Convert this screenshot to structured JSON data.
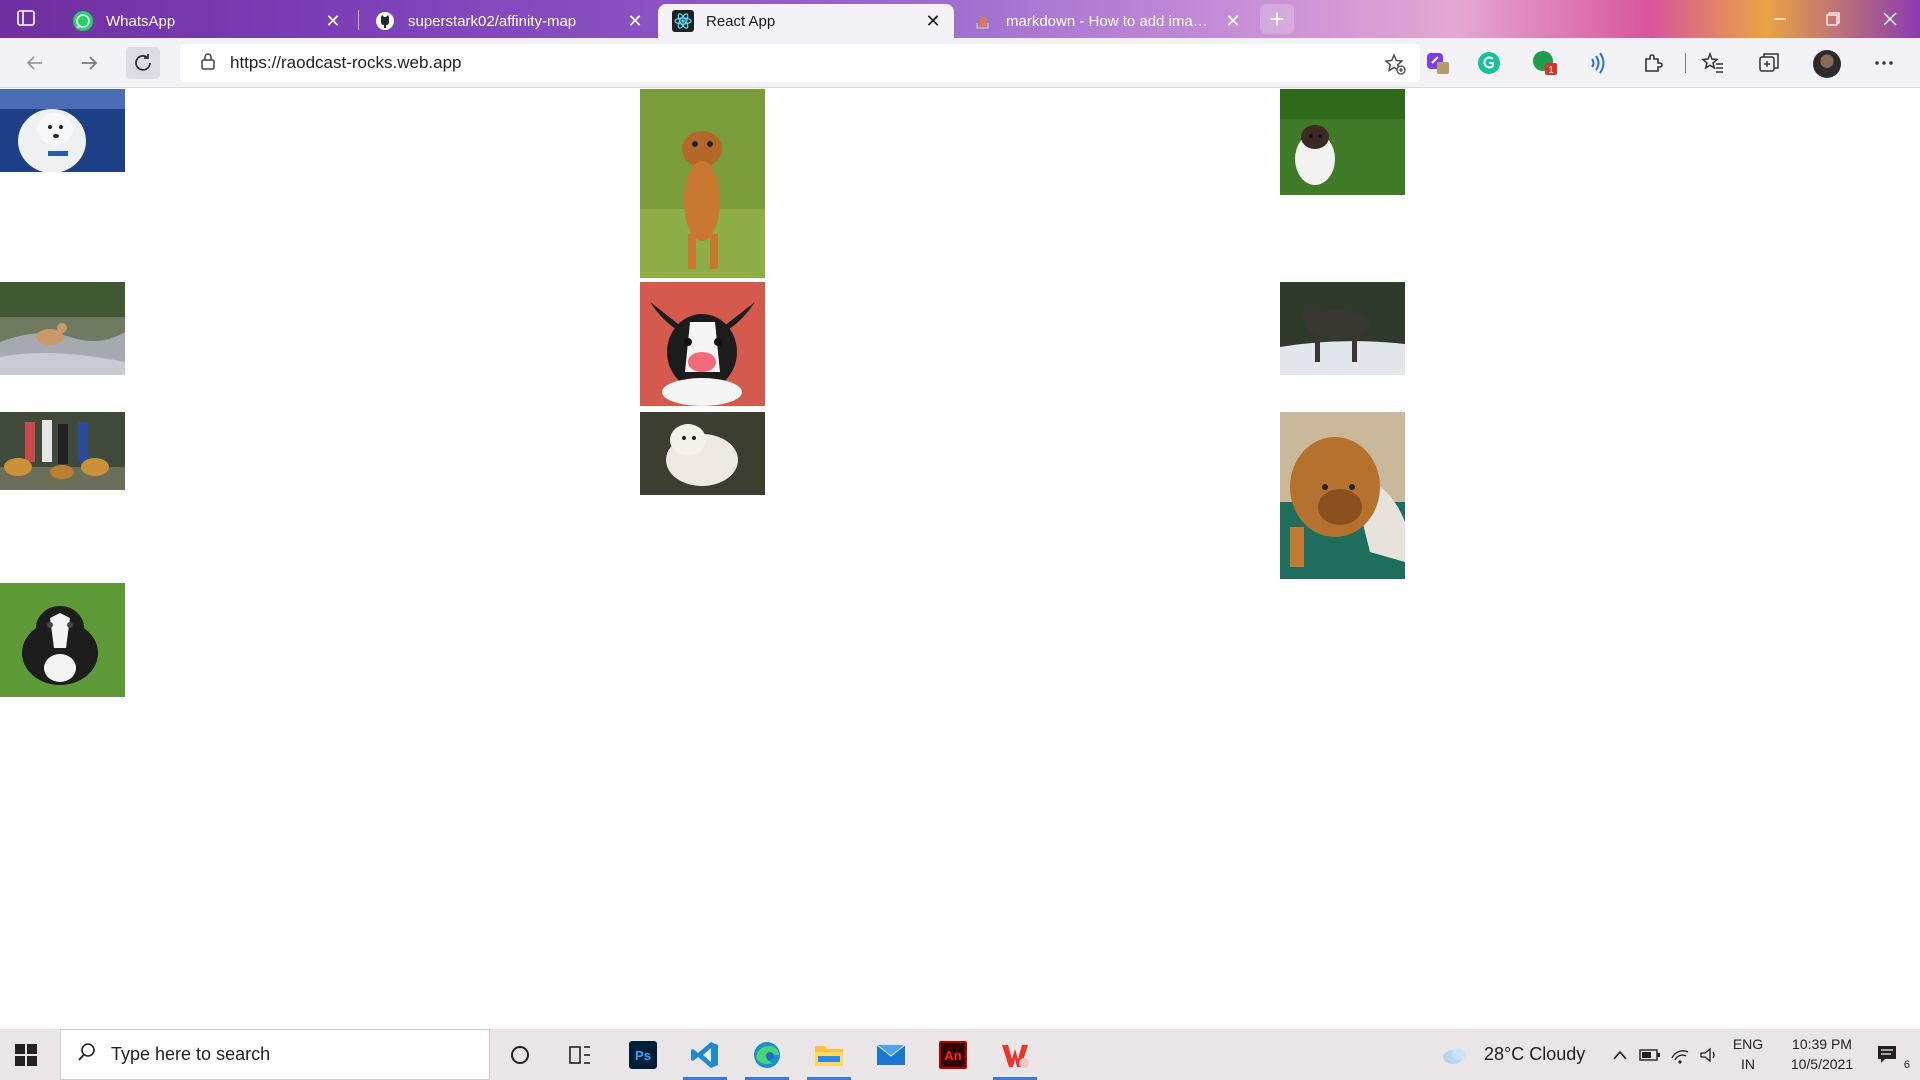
{
  "browser": {
    "tabs": [
      {
        "title": "WhatsApp",
        "active": false,
        "icon": "whatsapp-icon"
      },
      {
        "title": "superstark02/affinity-map",
        "active": false,
        "icon": "github-icon"
      },
      {
        "title": "React App",
        "active": true,
        "icon": "react-icon"
      },
      {
        "title": "markdown - How to add images",
        "active": false,
        "icon": "stackoverflow-icon"
      }
    ],
    "url": "https://raodcast-rocks.web.app"
  },
  "page": {
    "images": [
      {
        "subject": "white samoyed dog on blue background"
      },
      {
        "subject": "small brown dog standing on grass"
      },
      {
        "subject": "brown and white dog on green grass"
      },
      {
        "subject": "dog on rocky mountain trail"
      },
      {
        "subject": "papillon dog on red background"
      },
      {
        "subject": "grey wolfhound in snow"
      },
      {
        "subject": "group of people with golden dogs"
      },
      {
        "subject": "white fluffy dog on dark ground"
      },
      {
        "subject": "boxer dog lying on green rug"
      },
      {
        "subject": "boston terrier puppy on grass"
      }
    ]
  },
  "taskbar": {
    "search_placeholder": "Type here to search",
    "weather": "28°C  Cloudy",
    "language_line1": "ENG",
    "language_line2": "IN",
    "time": "10:39 PM",
    "date": "10/5/2021",
    "notifications_count": "6"
  },
  "colors": {
    "accent": "#3b7bd8",
    "whatsapp": "#25d366",
    "react": "#61dafb"
  }
}
